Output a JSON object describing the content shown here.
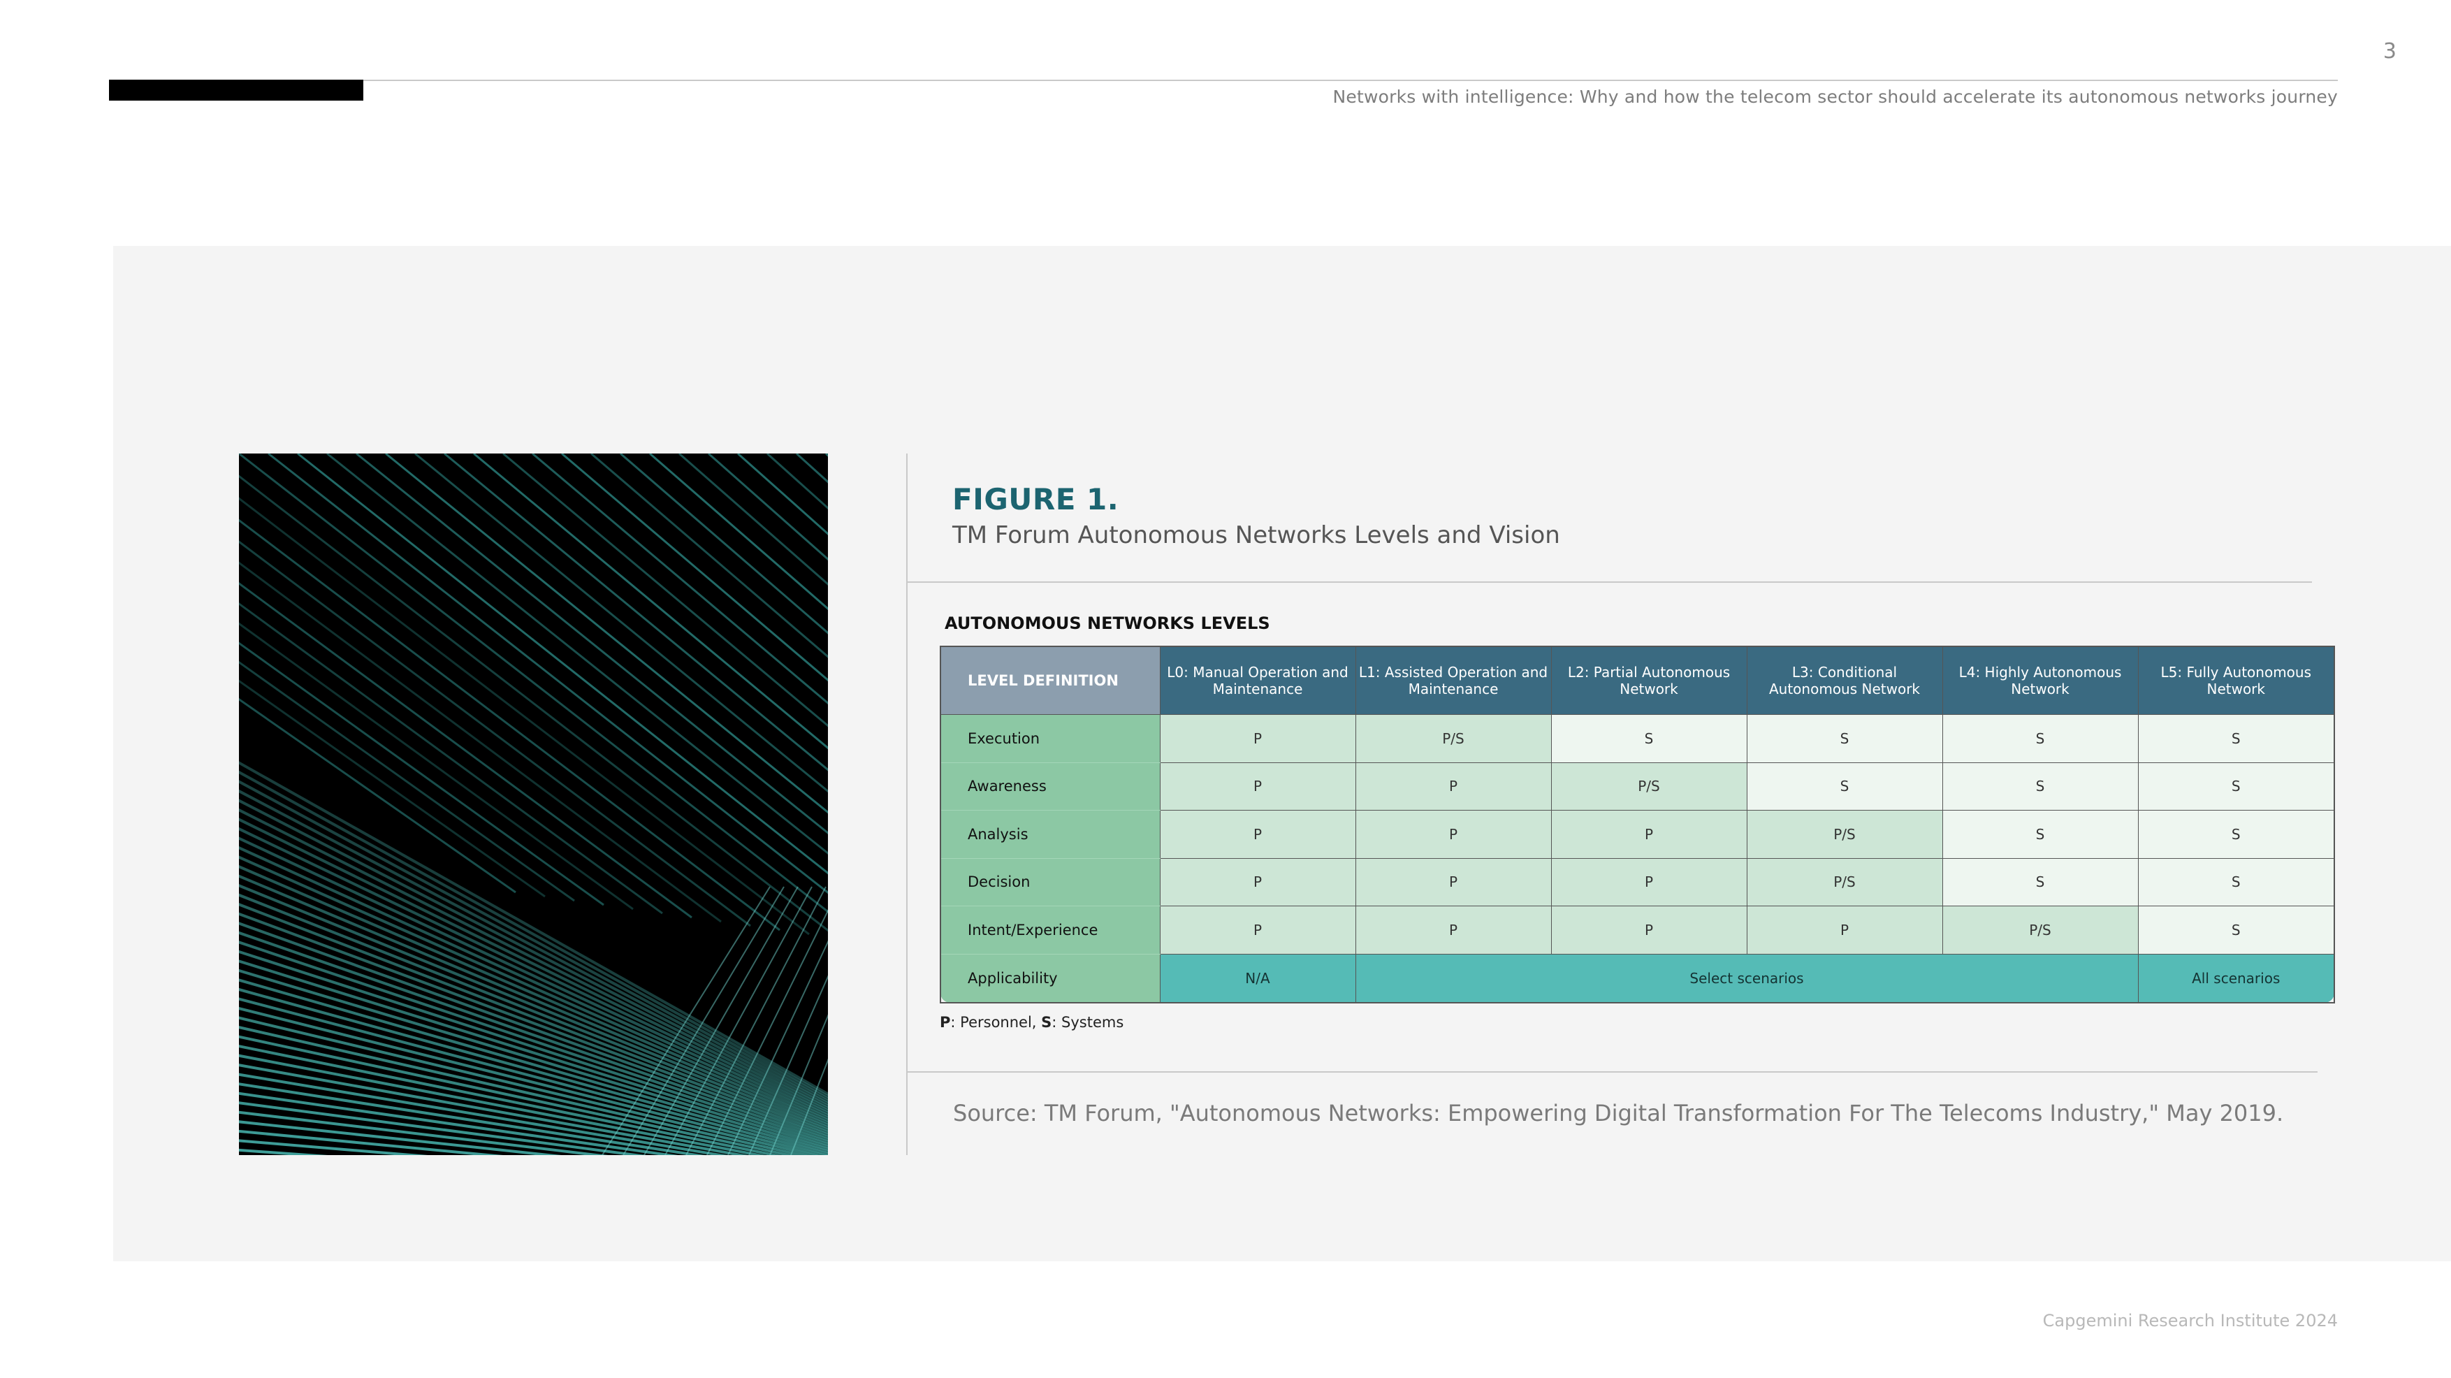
{
  "header": {
    "page_number": "3",
    "running_title": "Networks with intelligence:  Why and how the telecom sector should accelerate its autonomous networks journey"
  },
  "figure": {
    "label": "FIGURE 1.",
    "title": "TM Forum Autonomous Networks Levels and Vision",
    "table_heading": "AUTONOMOUS NETWORKS LEVELS",
    "corner_label": "LEVEL DEFINITION",
    "columns": [
      "L0: Manual Operation and Maintenance",
      "L1: Assisted Operation and Maintenance",
      "L2: Partial Autonomous Network",
      "L3: Conditional Autonomous Network",
      "L4: Highly Autonomous Network",
      "L5: Fully Autonomous Network"
    ],
    "rows": [
      {
        "label": "Execution",
        "cells": [
          "P",
          "P/S",
          "S",
          "S",
          "S",
          "S"
        ]
      },
      {
        "label": "Awareness",
        "cells": [
          "P",
          "P",
          "P/S",
          "S",
          "S",
          "S"
        ]
      },
      {
        "label": "Analysis",
        "cells": [
          "P",
          "P",
          "P",
          "P/S",
          "S",
          "S"
        ]
      },
      {
        "label": "Decision",
        "cells": [
          "P",
          "P",
          "P",
          "P/S",
          "S",
          "S"
        ]
      },
      {
        "label": "Intent/Experience",
        "cells": [
          "P",
          "P",
          "P",
          "P",
          "P/S",
          "S"
        ]
      }
    ],
    "applicability": {
      "label": "Applicability",
      "na": "N/A",
      "select": "Select scenarios",
      "all": "All scenarios"
    },
    "legend": {
      "p_key": "P",
      "p_text": ": Personnel, ",
      "s_key": "S",
      "s_text": ": Systems"
    },
    "source": "Source: TM Forum, \"Autonomous Networks: Empowering Digital Transformation For The Telecoms Industry,\" May 2019."
  },
  "footer": {
    "text": "Capgemini Research Institute 2024"
  },
  "colors": {
    "figure_label": "#1c6470",
    "header_cell": "#3a6a81",
    "row_header": "#8cc8a4",
    "personnel_cell": "#cde6d6",
    "system_cell": "#eef6f0",
    "applicability": "#55bbb6"
  }
}
